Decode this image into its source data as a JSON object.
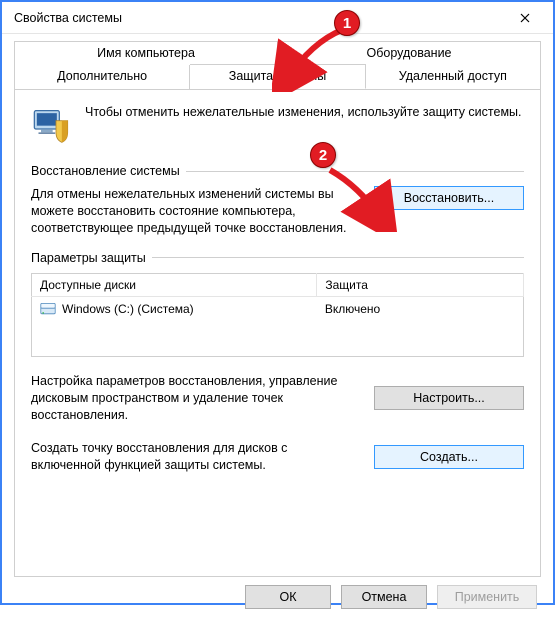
{
  "window": {
    "title": "Свойства системы"
  },
  "tabs": {
    "row1": [
      "Имя компьютера",
      "Оборудование"
    ],
    "row2": [
      "Дополнительно",
      "Защита системы",
      "Удаленный доступ"
    ],
    "active": "Защита системы"
  },
  "intro": "Чтобы отменить нежелательные изменения, используйте защиту системы.",
  "restore": {
    "legend": "Восстановление системы",
    "desc": "Для отмены нежелательных изменений системы вы можете восстановить состояние компьютера, соответствующее предыдущей точке восстановления.",
    "button": "Восстановить..."
  },
  "protection": {
    "legend": "Параметры защиты",
    "columns": [
      "Доступные диски",
      "Защита"
    ],
    "rows": [
      {
        "drive": "Windows (C:) (Система)",
        "status": "Включено"
      }
    ],
    "config_desc": "Настройка параметров восстановления, управление дисковым пространством и удаление точек восстановления.",
    "config_button": "Настроить...",
    "create_desc": "Создать точку восстановления для дисков с включенной функцией защиты системы.",
    "create_button": "Создать..."
  },
  "footer": {
    "ok": "ОК",
    "cancel": "Отмена",
    "apply": "Применить"
  },
  "annotations": {
    "b1": "1",
    "b2": "2"
  }
}
